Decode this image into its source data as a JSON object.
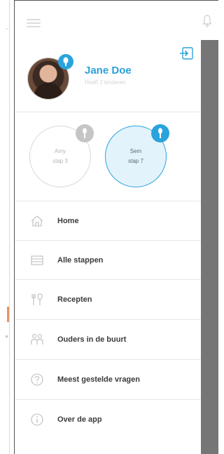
{
  "user": {
    "name": "Jane Doe",
    "subtitle": "Heeft 2 kinderen"
  },
  "children": [
    {
      "name": "Amy",
      "step": "stap 3",
      "active": false
    },
    {
      "name": "Sem",
      "step": "stap 7",
      "active": true
    }
  ],
  "menu": [
    {
      "label": "Home",
      "icon": "home-icon"
    },
    {
      "label": "Alle stappen",
      "icon": "list-icon"
    },
    {
      "label": "Recepten",
      "icon": "cutlery-icon"
    },
    {
      "label": "Ouders in de buurt",
      "icon": "parents-icon"
    },
    {
      "label": "Meest gestelde vragen",
      "icon": "question-icon"
    },
    {
      "label": "Over de app",
      "icon": "info-icon"
    }
  ],
  "colors": {
    "accent": "#2aa3dc",
    "overlay": "#767676",
    "muted": "#c5c5c5"
  }
}
